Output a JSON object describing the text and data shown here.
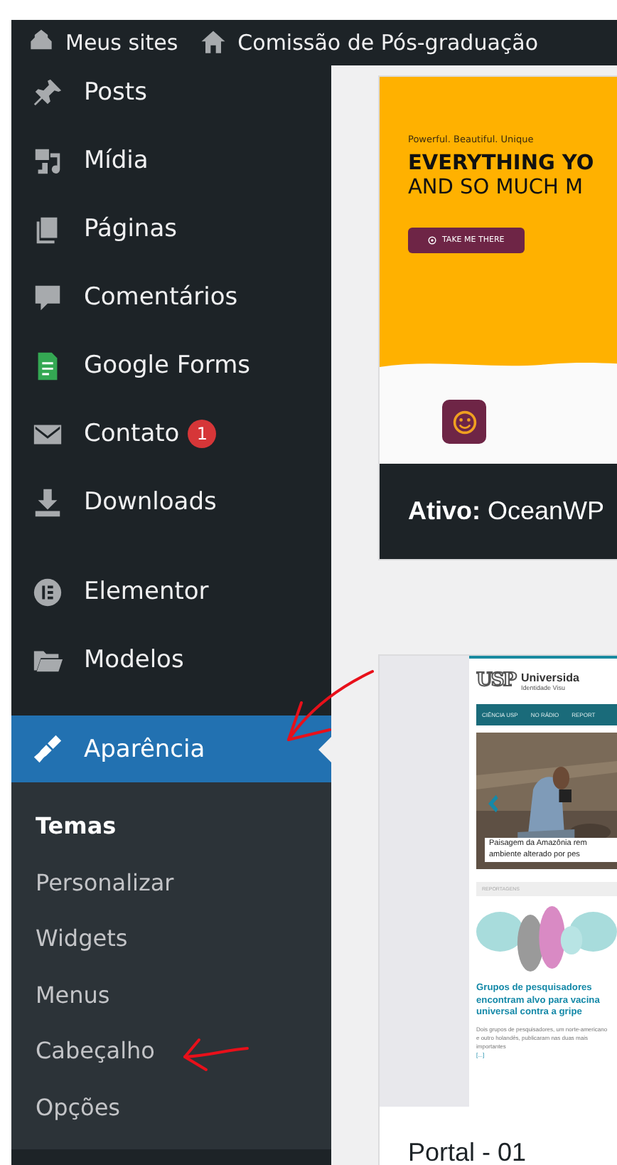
{
  "admin_bar": {
    "items": [
      {
        "label": "Meus sites",
        "kind": "sites"
      },
      {
        "label": "Comissão de Pós-graduação",
        "kind": "home"
      }
    ]
  },
  "sidebar": {
    "sections": [
      {
        "items": [
          {
            "label": "Posts",
            "kind": "pin",
            "selected": false
          },
          {
            "label": "Mídia",
            "kind": "media",
            "selected": false
          },
          {
            "label": "Páginas",
            "kind": "pages",
            "selected": false
          },
          {
            "label": "Comentários",
            "kind": "comments",
            "selected": false
          },
          {
            "label": "Google Forms",
            "kind": "forms",
            "selected": false
          },
          {
            "label": "Contato",
            "kind": "mail",
            "selected": false,
            "badge": "1"
          },
          {
            "label": "Downloads",
            "kind": "download",
            "selected": false
          }
        ]
      },
      {
        "items": [
          {
            "label": "Elementor",
            "kind": "elementor",
            "selected": false
          },
          {
            "label": "Modelos",
            "kind": "folder",
            "selected": false
          }
        ]
      },
      {
        "items": [
          {
            "label": "Aparência",
            "kind": "brush",
            "selected": true,
            "children": [
              {
                "label": "Temas",
                "selected": true
              },
              {
                "label": "Personalizar",
                "selected": false
              },
              {
                "label": "Widgets",
                "selected": false
              },
              {
                "label": "Menus",
                "selected": false
              },
              {
                "label": "Cabeçalho",
                "selected": false
              },
              {
                "label": "Opções",
                "selected": false
              }
            ]
          }
        ]
      }
    ]
  },
  "themes": [
    {
      "active": true,
      "label": "**Ativo:** OceanWP",
      "preview": {
        "kind": "landing",
        "tagline": "Powerful. Beautiful. Unique",
        "headline": [
          "EVERYTHING YO",
          "AND SO MUCH M"
        ],
        "button": "TAKE ME THERE"
      }
    },
    {
      "active": false,
      "label": "Portal - 01",
      "preview": {
        "kind": "portal",
        "logo": "USP",
        "title": "Universida",
        "subtitle": "Identidade Visu",
        "nav": [
          "CIÊNCIA USP",
          "NO RÁDIO",
          "REPORT"
        ],
        "caption": [
          "Paisagem da Amazônia rem",
          "ambiente alterado por pes"
        ],
        "section": "REPORTAGENS",
        "headline": "Grupos de pesquisadores encontram alvo para vacina universal contra a gripe",
        "excerpt": "Dois grupos de pesquisadores, um norte-americano e outro holandês, publicaram nas duas mais importantes",
        "more": "[...]"
      }
    }
  ]
}
